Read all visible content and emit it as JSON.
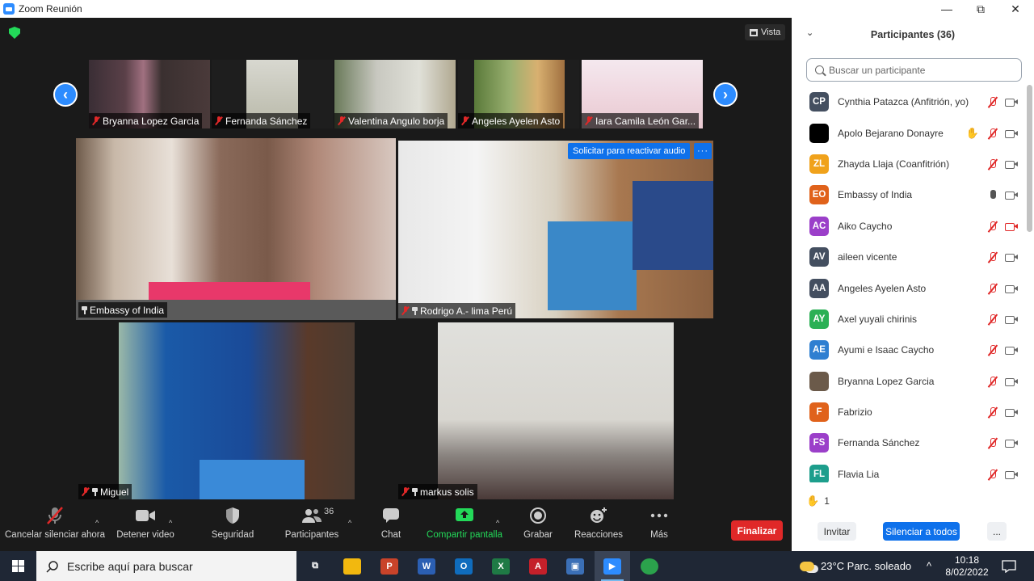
{
  "window": {
    "title": "Zoom Reunión",
    "minimize": "—",
    "restore": "⧉",
    "close": "✕"
  },
  "meeting": {
    "view_label": "Vista",
    "nav_prev": "‹",
    "nav_next": "›",
    "thumbnails": [
      {
        "name": "Bryanna Lopez Garcia",
        "muted": true
      },
      {
        "name": "Fernanda Sánchez",
        "muted": true
      },
      {
        "name": "Valentina Angulo borja",
        "muted": true
      },
      {
        "name": "Angeles Ayelen Asto",
        "muted": true
      },
      {
        "name": "Iara Camila León Gar...",
        "muted": true
      }
    ],
    "tiles": [
      {
        "name": "Embassy of India",
        "pinned": true,
        "active": true
      },
      {
        "name": "Rodrigo A.- lima Perú",
        "pinned": true,
        "muted": true
      },
      {
        "name": "Miguel",
        "pinned": true,
        "muted": true
      },
      {
        "name": "markus solis",
        "pinned": true,
        "muted": true
      }
    ],
    "request_audio": "Solicitar para reactivar audio",
    "tile_more": "···"
  },
  "toolbar": {
    "unmute": "Cancelar silenciar ahora",
    "stop_video": "Detener video",
    "security": "Seguridad",
    "participants": "Participantes",
    "participants_count": "36",
    "chat": "Chat",
    "share": "Compartir pantalla",
    "record": "Grabar",
    "reactions": "Reacciones",
    "more": "Más",
    "end": "Finalizar"
  },
  "panel": {
    "title": "Participantes (36)",
    "search_placeholder": "Buscar un participante",
    "participants": [
      {
        "initials": "CP",
        "color": "#444f60",
        "name": "Cynthia Patazca (Anfitrión, yo)",
        "mic": "off",
        "cam": "on"
      },
      {
        "initials": "",
        "color": "#000000",
        "name": "Apolo Bejarano Donayre",
        "hand": true,
        "mic": "off",
        "cam": "on"
      },
      {
        "initials": "ZL",
        "color": "#f0a21b",
        "name": "Zhayda Llaja (Coanfitrión)",
        "mic": "off",
        "cam": "on"
      },
      {
        "initials": "EO",
        "color": "#e0621b",
        "name": "Embassy of India",
        "mic": "on",
        "cam": "on"
      },
      {
        "initials": "AC",
        "color": "#9b3fc9",
        "name": "Aiko Caycho",
        "mic": "off",
        "cam": "off"
      },
      {
        "initials": "AV",
        "color": "#444f60",
        "name": "aileen vicente",
        "mic": "off",
        "cam": "on"
      },
      {
        "initials": "AA",
        "color": "#444f60",
        "name": "Angeles Ayelen Asto",
        "mic": "off",
        "cam": "on"
      },
      {
        "initials": "AY",
        "color": "#2bb055",
        "name": "Axel yuyali chirinis",
        "mic": "off",
        "cam": "on"
      },
      {
        "initials": "AE",
        "color": "#2f7fd1",
        "name": "Ayumi e Isaac Caycho",
        "mic": "off",
        "cam": "on"
      },
      {
        "initials": "",
        "color": "#6b5a4a",
        "name": "Bryanna Lopez Garcia",
        "mic": "off",
        "cam": "on"
      },
      {
        "initials": "F",
        "color": "#e0621b",
        "name": "Fabrizio",
        "mic": "off",
        "cam": "on"
      },
      {
        "initials": "FS",
        "color": "#9b3fc9",
        "name": "Fernanda Sánchez",
        "mic": "off",
        "cam": "on"
      },
      {
        "initials": "FL",
        "color": "#1d9e8c",
        "name": "Flavia Lia",
        "mic": "off",
        "cam": "on"
      }
    ],
    "raised_hands": "1",
    "invite": "Invitar",
    "mute_all": "Silenciar a todos",
    "more": "..."
  },
  "taskbar": {
    "search_placeholder": "Escribe aquí para buscar",
    "weather": "23°C  Parc. soleado",
    "time": "10:18",
    "date": "8/02/2022",
    "apps": [
      {
        "name": "task-view",
        "glyph": "⧉",
        "color": "transparent"
      },
      {
        "name": "file-explorer",
        "glyph": "",
        "color": "#f2b80f"
      },
      {
        "name": "powerpoint",
        "glyph": "P",
        "color": "#c9432a"
      },
      {
        "name": "word",
        "glyph": "W",
        "color": "#2b5fb3"
      },
      {
        "name": "outlook",
        "glyph": "O",
        "color": "#0f6cbd"
      },
      {
        "name": "excel",
        "glyph": "X",
        "color": "#1f7a45"
      },
      {
        "name": "acrobat",
        "glyph": "A",
        "color": "#c4202a"
      },
      {
        "name": "remote-desktop",
        "glyph": "▣",
        "color": "#3b6fb6"
      },
      {
        "name": "zoom",
        "glyph": "▶",
        "color": "#2d8cff"
      },
      {
        "name": "chrome",
        "glyph": "",
        "color": "#2ba24c"
      }
    ]
  }
}
